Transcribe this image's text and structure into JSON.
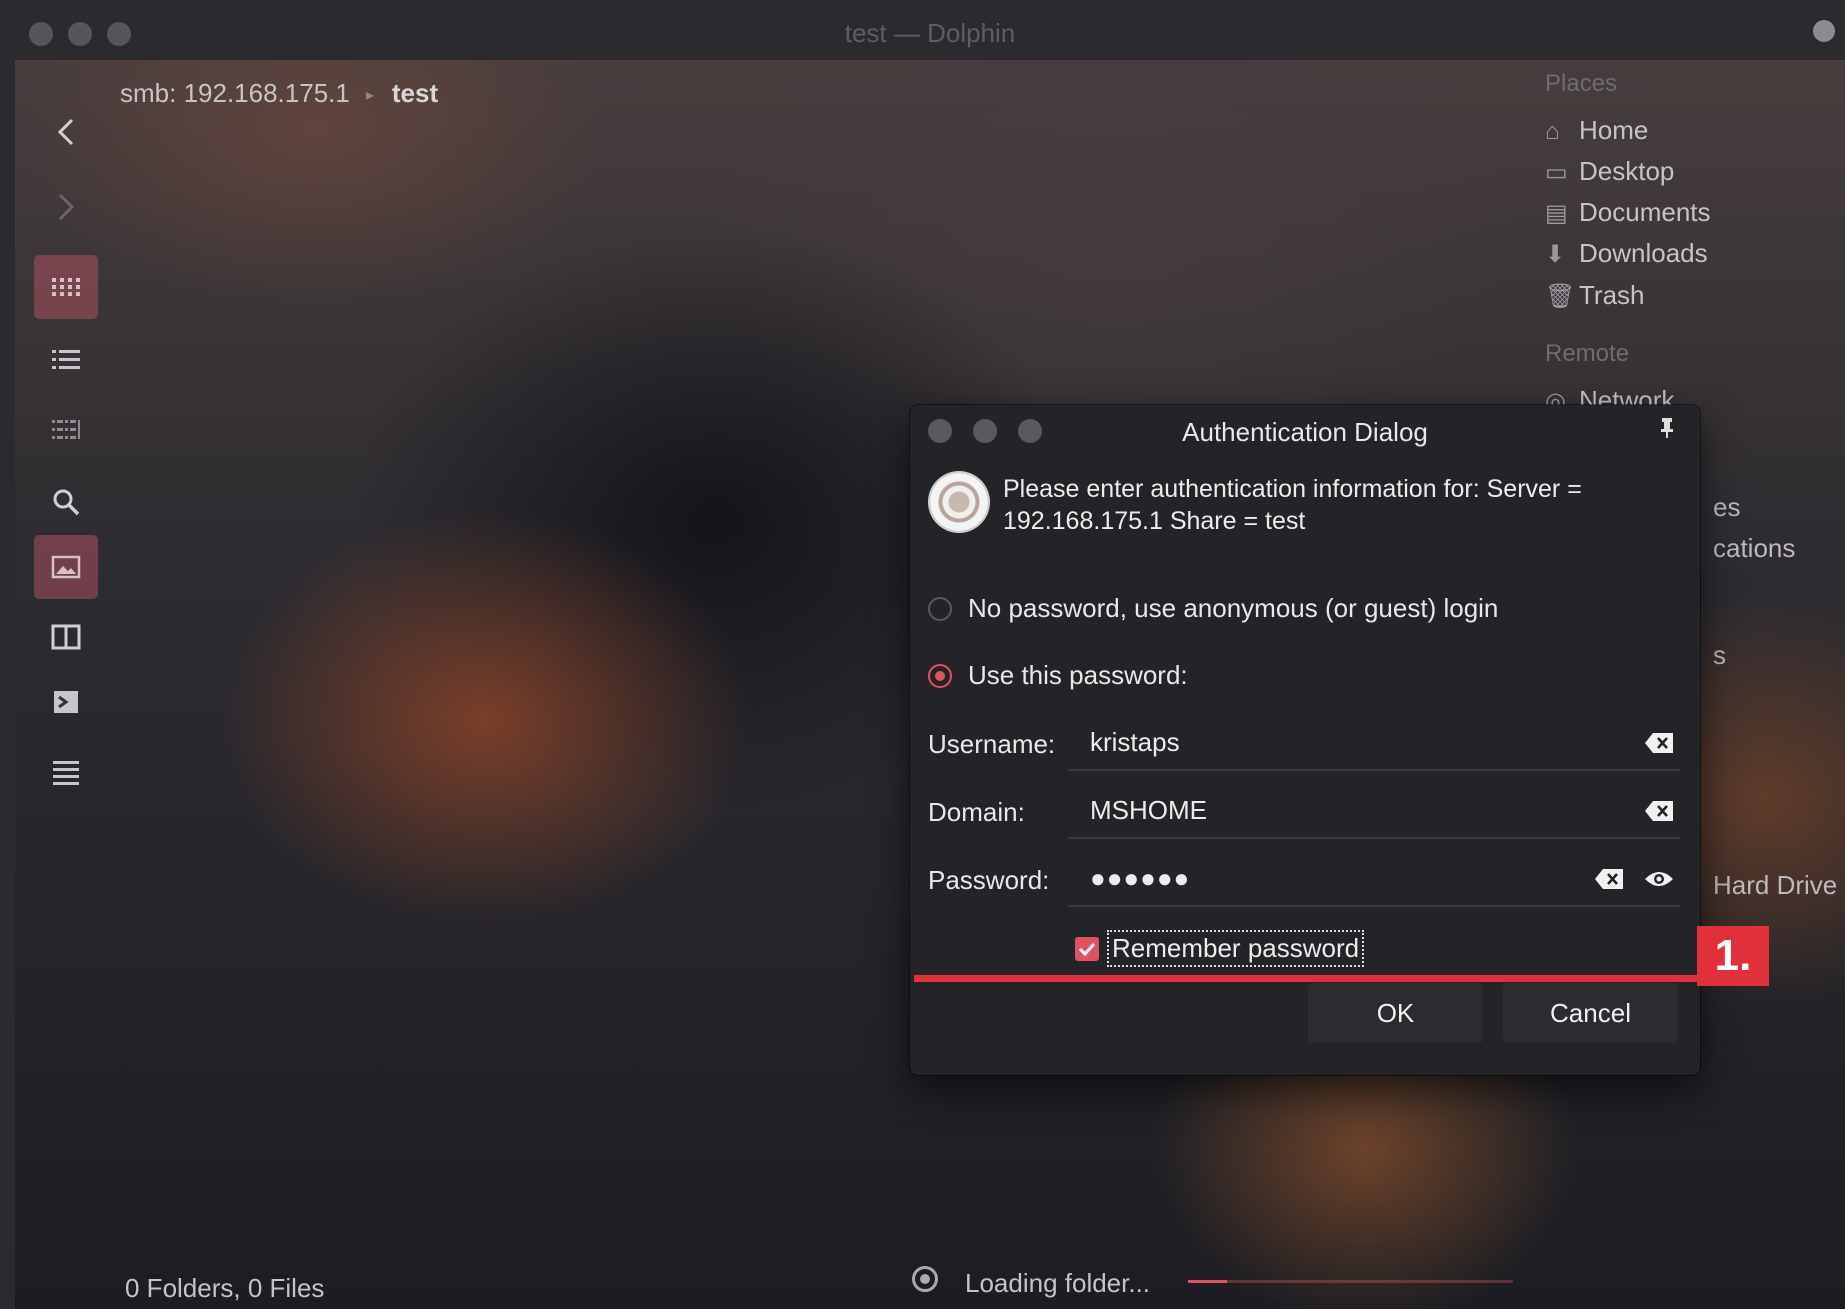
{
  "window": {
    "title": "test — Dolphin"
  },
  "breadcrumb": {
    "path": "smb: 192.168.175.1",
    "current": "test"
  },
  "places": {
    "section_places": "Places",
    "items": [
      {
        "icon": "home-icon",
        "label": "Home"
      },
      {
        "icon": "desktop-icon",
        "label": "Desktop"
      },
      {
        "icon": "documents-icon",
        "label": "Documents"
      },
      {
        "icon": "downloads-icon",
        "label": "Downloads"
      },
      {
        "icon": "trash-icon",
        "label": "Trash"
      }
    ],
    "section_remote": "Remote",
    "network_label": "Network",
    "partial_1": "es",
    "partial_2": "cations",
    "partial_3": "s",
    "partial_4": "Hard Drive"
  },
  "statusbar": {
    "summary": "0 Folders, 0 Files",
    "loading": "Loading folder...",
    "progress": 0.12
  },
  "dialog": {
    "title": "Authentication Dialog",
    "prompt": "Please enter authentication information for: Server = 192.168.175.1 Share = test",
    "option_anonymous": "No password, use anonymous (or guest) login",
    "option_password": "Use this password:",
    "selected_option": "password",
    "username_label": "Username:",
    "username_value": "kristaps",
    "domain_label": "Domain:",
    "domain_value": "MSHOME",
    "password_label": "Password:",
    "password_masked": "●●●●●●",
    "remember_label": "Remember password",
    "remember_checked": true,
    "ok_label": "OK",
    "cancel_label": "Cancel"
  },
  "annotation": {
    "step": "1.",
    "color": "#e0313b"
  },
  "colors": {
    "accent": "#e0525f"
  }
}
